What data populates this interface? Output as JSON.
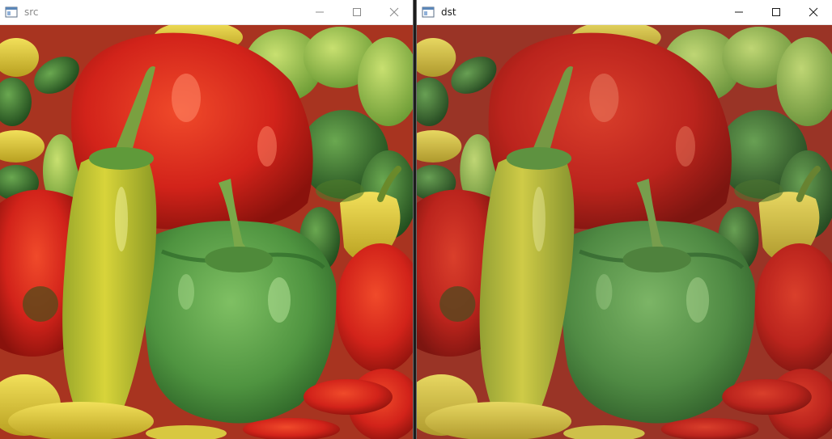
{
  "windows": [
    {
      "id": "src",
      "title": "src",
      "active": false,
      "controls": [
        "minimize-icon",
        "maximize-icon",
        "close-icon"
      ],
      "image": {
        "description_key": "peppers"
      }
    },
    {
      "id": "dst",
      "title": "dst",
      "active": true,
      "controls": [
        "minimize-icon",
        "maximize-icon",
        "close-icon"
      ],
      "image": {
        "description_key": "peppers-smoothed"
      }
    }
  ],
  "colors": {
    "bg_red": "#b23a22",
    "pepper_red": "#d62a1a",
    "pepper_red_dark": "#8f1710",
    "pepper_green": "#5fa34a",
    "pepper_green_dark": "#2f6a2a",
    "pepper_yellow": "#d6cc3a",
    "pepper_lightgreen": "#a8c84a",
    "inactive_title": "#8a8a8a",
    "active_title": "#1a1a1a"
  }
}
